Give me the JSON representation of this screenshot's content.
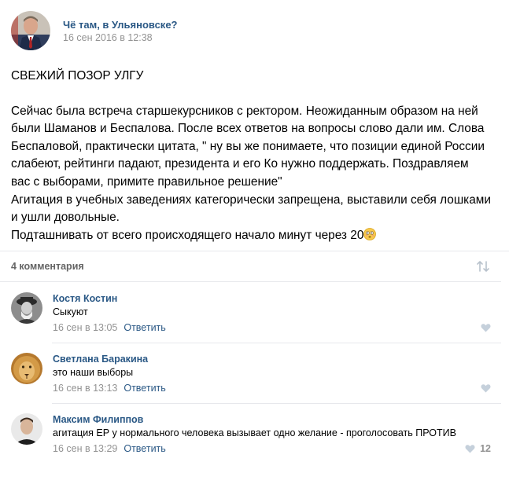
{
  "post": {
    "author": "Чё там, в Ульяновске?",
    "date": "16 сен 2016 в 12:38",
    "lines": [
      "СВЕЖИЙ ПОЗОР УЛГУ",
      "",
      "Сейчас была встреча старшекурсников с ректором. Неожиданным образом на ней",
      "были Шаманов и Беспалова. После всех ответов на вопросы слово дали им. Слова",
      "Беспаловой, практически цитата, \" ну вы же понимаете, что позиции единой России",
      "слабеют, рейтинги падают, президента и его Ко нужно поддержать. Поздравляем",
      "вас с выборами, примите правильное решение\"",
      "Агитация в учебных заведениях категорически запрещена, выставили себя лошками",
      "и ушли довольные.",
      "Подташнивать от всего происходящего начало минут через 20"
    ]
  },
  "comments_bar": {
    "count_label": "4 комментария"
  },
  "comments": [
    {
      "author": "Костя Костин",
      "text": "Сыкуют",
      "date": "16 сен в 13:05",
      "reply_label": "Ответить",
      "likes": ""
    },
    {
      "author": "Светлана Баракина",
      "text": "это наши выборы",
      "date": "16 сен в 13:13",
      "reply_label": "Ответить",
      "likes": ""
    },
    {
      "author": "Максим Филиппов",
      "text": "агитация ЕР у нормального человека вызывает одно желание - проголосовать ПРОТИВ",
      "date": "16 сен в 13:29",
      "reply_label": "Ответить",
      "likes": "12"
    }
  ],
  "icons": {
    "sort": "sort-arrows-icon",
    "like": "heart-icon",
    "emoji": "flushed-face-emoji"
  },
  "colors": {
    "link": "#2a5885",
    "meta": "#939393",
    "divider": "#e7e8ec",
    "heart": "#c5d0db"
  }
}
